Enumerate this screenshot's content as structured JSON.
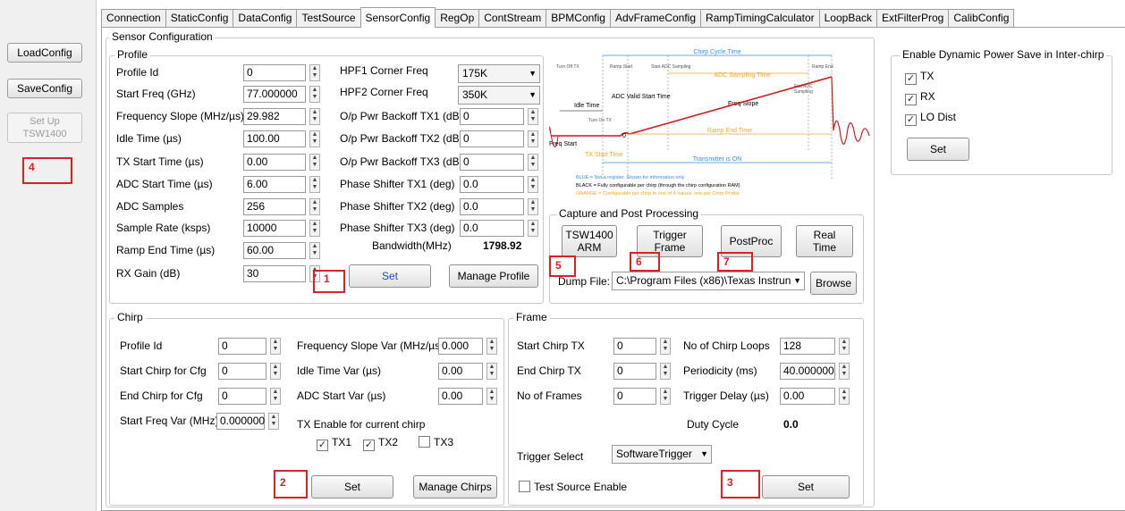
{
  "left": {
    "load_label": "LoadConfig",
    "save_label": "SaveConfig",
    "setup_label_1": "Set Up",
    "setup_label_2": "TSW1400"
  },
  "tabs": [
    "Connection",
    "StaticConfig",
    "DataConfig",
    "TestSource",
    "SensorConfig",
    "RegOp",
    "ContStream",
    "BPMConfig",
    "AdvFrameConfig",
    "RampTimingCalculator",
    "LoopBack",
    "ExtFilterProg",
    "CalibConfig"
  ],
  "active_tab": "SensorConfig",
  "sensor_title": "Sensor Configuration",
  "profile": {
    "title": "Profile",
    "fields": [
      {
        "label": "Profile Id",
        "value": "0"
      },
      {
        "label": "Start Freq (GHz)",
        "value": "77.000000"
      },
      {
        "label": "Frequency Slope (MHz/µs)",
        "value": "29.982"
      },
      {
        "label": "Idle Time (µs)",
        "value": "100.00"
      },
      {
        "label": "TX Start Time (µs)",
        "value": "0.00"
      },
      {
        "label": "ADC Start Time (µs)",
        "value": "6.00"
      },
      {
        "label": "ADC Samples",
        "value": "256"
      },
      {
        "label": "Sample Rate (ksps)",
        "value": "10000"
      },
      {
        "label": "Ramp End Time (µs)",
        "value": "60.00"
      },
      {
        "label": "RX Gain (dB)",
        "value": "30"
      }
    ],
    "hpf1_label": "HPF1 Corner Freq",
    "hpf1_value": "175K",
    "hpf2_label": "HPF2 Corner Freq",
    "hpf2_value": "350K",
    "fields2": [
      {
        "label": "O/p Pwr Backoff TX1 (dB)",
        "value": "0"
      },
      {
        "label": "O/p Pwr Backoff TX2 (dB)",
        "value": "0"
      },
      {
        "label": "O/p Pwr Backoff TX3 (dB)",
        "value": "0"
      },
      {
        "label": "Phase Shifter TX1 (deg)",
        "value": "0.0"
      },
      {
        "label": "Phase Shifter TX2 (deg)",
        "value": "0.0"
      },
      {
        "label": "Phase Shifter TX3 (deg)",
        "value": "0.0"
      }
    ],
    "bandwidth_label": "Bandwidth(MHz)",
    "bandwidth_value": "1798.92",
    "set_label": "Set",
    "manage_label": "Manage Profile"
  },
  "diagram": {
    "chirp_cycle": "Chirp Cycle Time",
    "turn_off_tx": "Turn Off TX",
    "ramp_start": "Ramp Start",
    "start_adc": "Start ADC Sampling",
    "ramp_end": "Ramp End",
    "adc_sampling_time": "ADC Sampling Time",
    "end_adc_1": "End ADC",
    "end_adc_2": "Sampling",
    "adc_valid": "ADC Valid Start Time",
    "idle_time": "Idle Time",
    "freq_slope": "Freq Slope",
    "turn_on_tx": "Turn On TX",
    "zero": "0",
    "ramp_end_time": "Ramp End Time",
    "freq_start": "Freq Start",
    "tx_start_time": "TX Start Time",
    "tx_on": "Transmitter is ON",
    "legend_blue": "BLUE = Not a register. Shown for information only",
    "legend_black": "BLACK = Fully configurable per chirp (through the chirp configuration RAM)",
    "legend_orange": "ORANGE = Configurable per chirp to one of 4 values, one per Chirp Profile",
    "colors": {
      "blue": "#3a8ee6",
      "orange": "#f5a623",
      "red": "#d0191b"
    }
  },
  "power": {
    "title": "Enable Dynamic Power Save in Inter-chirp",
    "tx": "TX",
    "rx": "RX",
    "lo": "LO Dist",
    "tx_checked": true,
    "rx_checked": true,
    "lo_checked": true,
    "set_label": "Set"
  },
  "capture": {
    "title": "Capture and Post Processing",
    "arm_1": "TSW1400",
    "arm_2": "ARM",
    "trig_1": "Trigger",
    "trig_2": "Frame",
    "postproc": "PostProc",
    "rt_1": "Real",
    "rt_2": "Time",
    "dump_label": "Dump File:",
    "dump_value": "C:\\Program Files (x86)\\Texas Instrun",
    "browse": "Browse"
  },
  "chirp": {
    "title": "Chirp",
    "left_fields": [
      {
        "label": "Profile Id",
        "value": "0"
      },
      {
        "label": "Start Chirp for Cfg",
        "value": "0"
      },
      {
        "label": "End Chirp for Cfg",
        "value": "0"
      },
      {
        "label": "Start Freq Var (MHz)",
        "value": "0.000000"
      }
    ],
    "right_fields": [
      {
        "label": "Frequency Slope Var (MHz/µs)",
        "value": "0.000"
      },
      {
        "label": "Idle Time Var (µs)",
        "value": "0.00"
      },
      {
        "label": "ADC Start Var (µs)",
        "value": "0.00"
      }
    ],
    "tx_enable_label": "TX Enable for current chirp",
    "tx1": "TX1",
    "tx2": "TX2",
    "tx3": "TX3",
    "tx1_checked": true,
    "tx2_checked": true,
    "tx3_checked": false,
    "set_label": "Set",
    "manage_label": "Manage Chirps"
  },
  "frame": {
    "title": "Frame",
    "left_fields": [
      {
        "label": "Start Chirp TX",
        "value": "0"
      },
      {
        "label": "End Chirp TX",
        "value": "0"
      },
      {
        "label": "No of Frames",
        "value": "0"
      }
    ],
    "right_fields": [
      {
        "label": "No of Chirp Loops",
        "value": "128"
      },
      {
        "label": "Periodicity (ms)",
        "value": "40.000000"
      },
      {
        "label": "Trigger Delay (µs)",
        "value": "0.00"
      }
    ],
    "duty_label": "Duty Cycle",
    "duty_value": "0.0",
    "trigger_label": "Trigger Select",
    "trigger_value": "SoftwareTrigger",
    "test_source_label": "Test Source Enable",
    "test_source_checked": false,
    "set_label": "Set"
  },
  "markers": [
    "1",
    "2",
    "3",
    "4",
    "5",
    "6",
    "7"
  ],
  "marker_color": "#e02020"
}
